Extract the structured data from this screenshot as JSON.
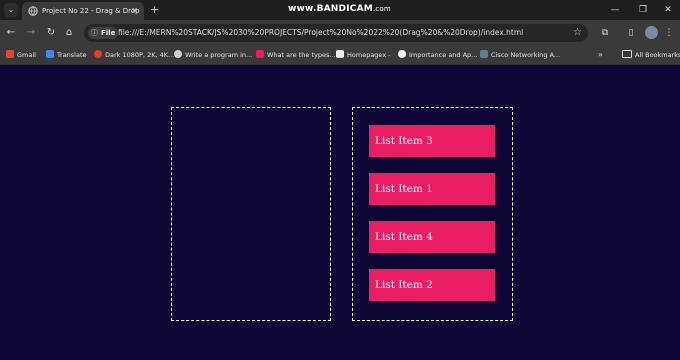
{
  "browser": {
    "tab_title": "Project No 22 - Drag & Drop",
    "watermark_main": "www.BANDICAM",
    "watermark_suffix": ".com",
    "address_chip": "File",
    "url": "file:///E:/MERN%20STACK/JS%2030%20PROJECTS/Project%20No%2022%20(Drag%20&%20Drop)/index.html",
    "bookmarks": [
      {
        "label": "Gmail",
        "color": "#ea4335"
      },
      {
        "label": "Translate",
        "color": "#4285f4"
      },
      {
        "label": "Dark 1080P, 2K, 4K...",
        "color": "#e53935"
      },
      {
        "label": "Write a program in...",
        "color": "#cfcfcf"
      },
      {
        "label": "What are the types...",
        "color": "#e91e63"
      },
      {
        "label": "Homepagex -",
        "color": "#eeeeee"
      },
      {
        "label": "Importance and Ap...",
        "color": "#ffffff"
      },
      {
        "label": "Cisco Networking A...",
        "color": "#607d8b"
      }
    ],
    "all_bookmarks": "All Bookmarks"
  },
  "page": {
    "background": "#0c0536",
    "item_color": "#e91e63",
    "right_box_items": [
      "List Item 3",
      "List Item 1",
      "List Item 4",
      "List Item 2"
    ]
  }
}
